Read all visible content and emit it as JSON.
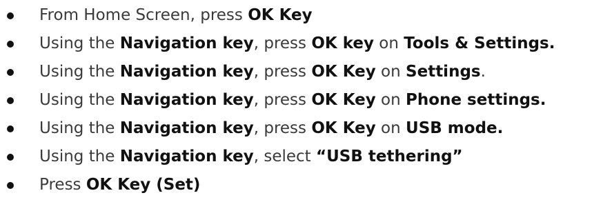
{
  "steps": [
    {
      "parts": [
        "From Home Screen, press ",
        "OK Key"
      ]
    },
    {
      "parts": [
        "Using the ",
        "Navigation key",
        ", press ",
        "OK key",
        " on ",
        "Tools & Settings."
      ]
    },
    {
      "parts": [
        "Using the ",
        "Navigation key",
        ", press ",
        "OK Key",
        " on ",
        "Settings",
        "."
      ]
    },
    {
      "parts": [
        "Using the ",
        "Navigation key",
        ", press ",
        "OK Key",
        " on ",
        "Phone settings."
      ]
    },
    {
      "parts": [
        "Using the ",
        "Navigation key",
        ", press ",
        "OK Key",
        " on ",
        "USB mode."
      ]
    },
    {
      "parts": [
        "Using the ",
        "Navigation key",
        ", select ",
        "“USB tethering”"
      ]
    },
    {
      "parts": [
        "Press ",
        "OK Key (Set)"
      ]
    }
  ]
}
